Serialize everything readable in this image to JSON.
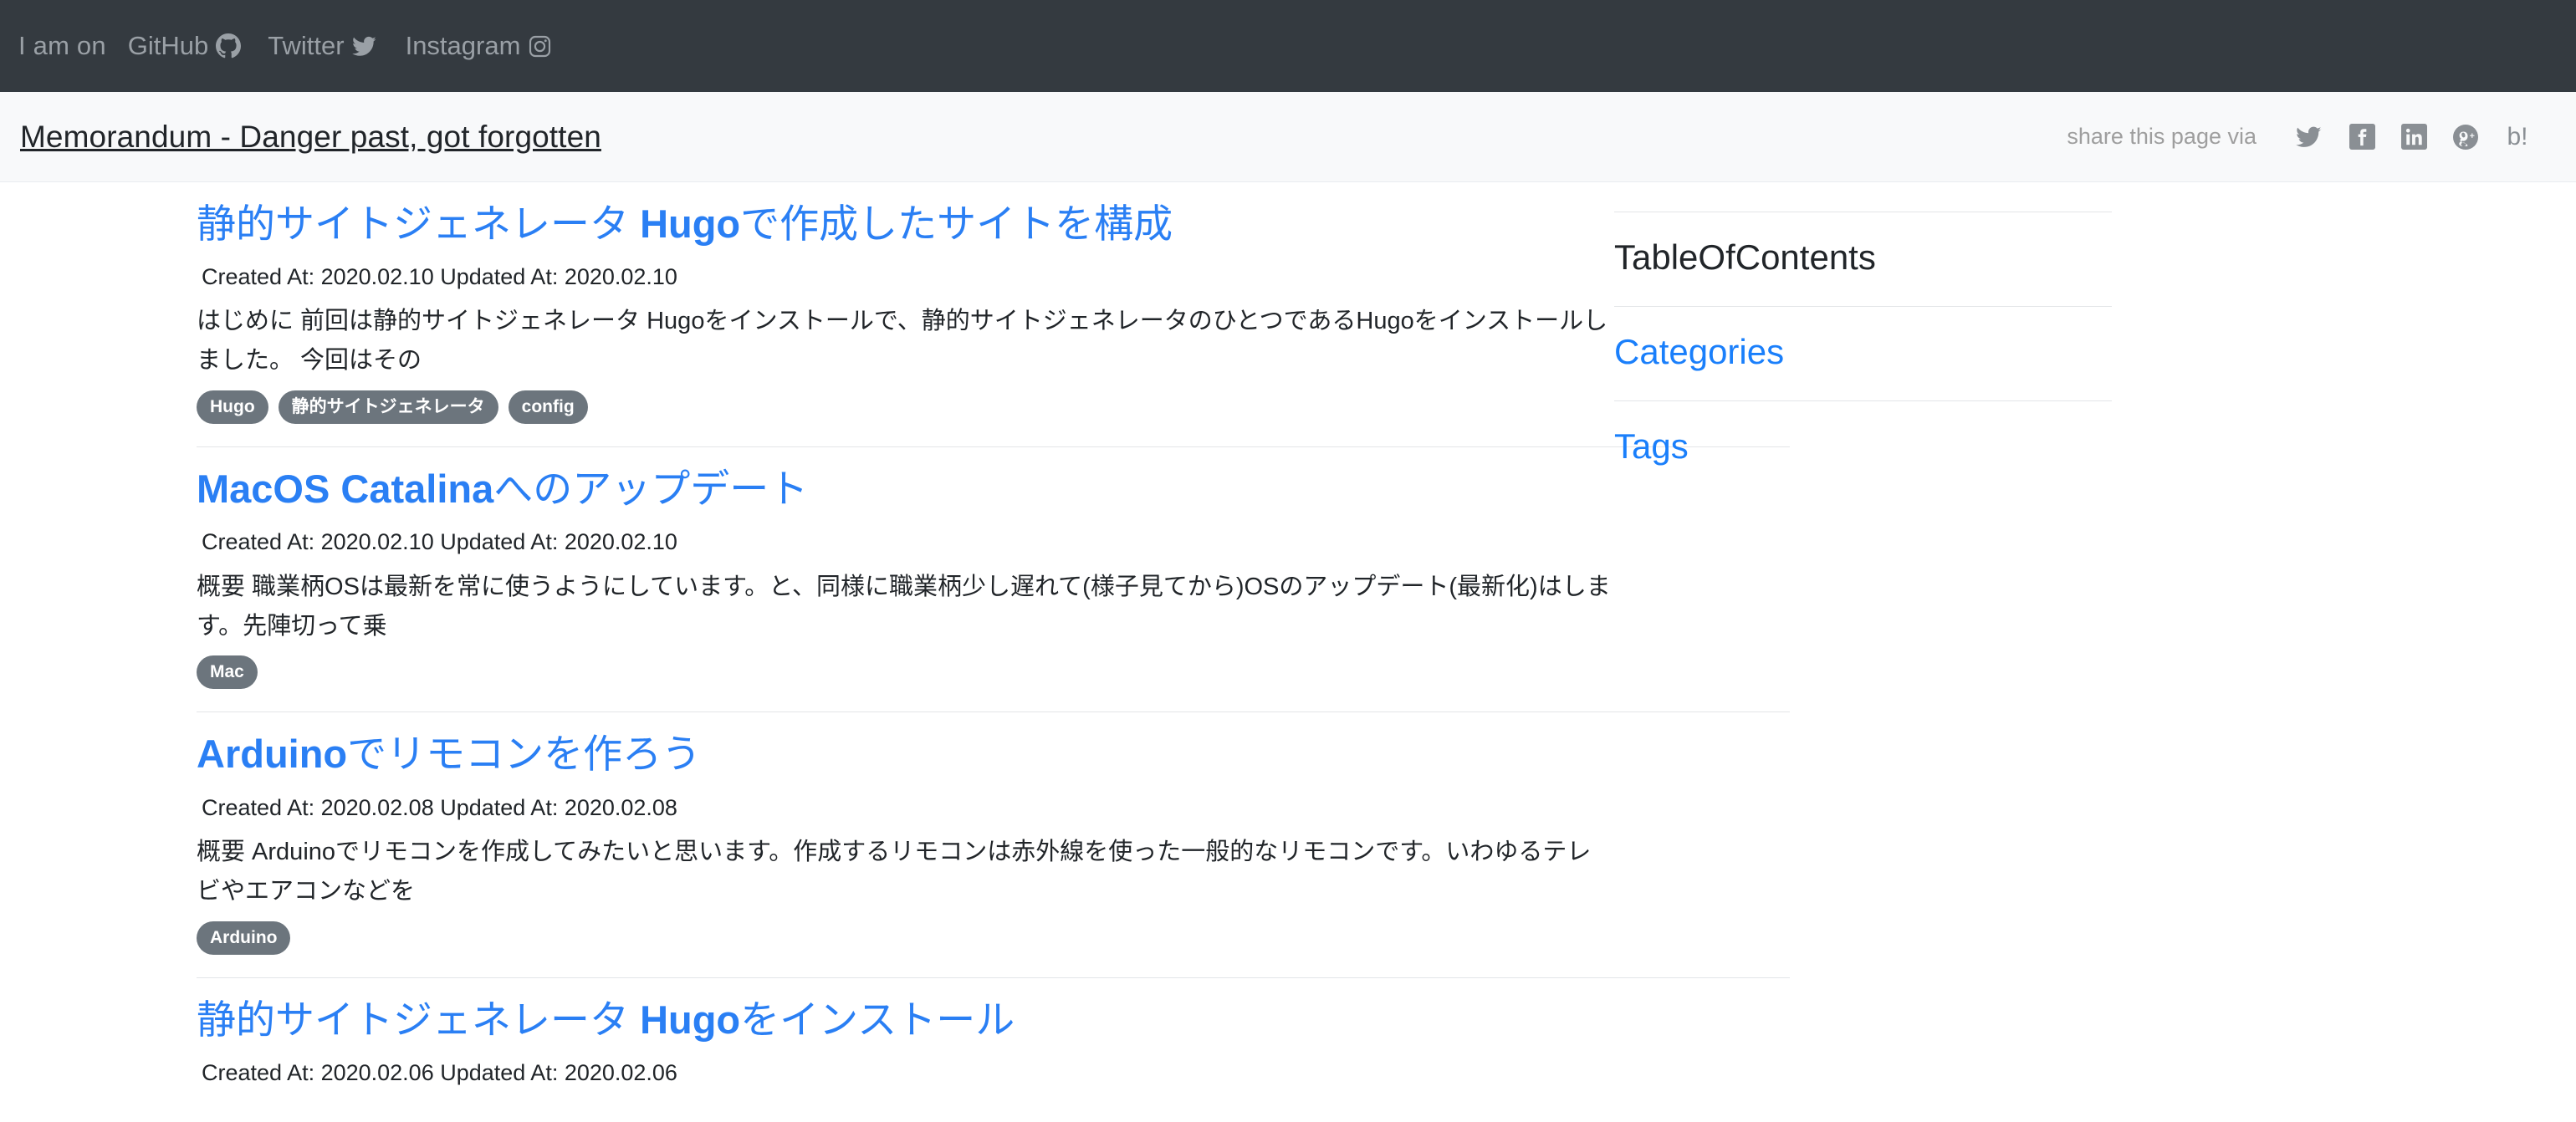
{
  "topnav": {
    "label": "I am on",
    "links": [
      {
        "text": "GitHub",
        "icon": "github-icon"
      },
      {
        "text": "Twitter",
        "icon": "twitter-icon"
      },
      {
        "text": "Instagram",
        "icon": "instagram-icon"
      }
    ],
    "background_color": "#343a40",
    "text_color": "#9aa0a6"
  },
  "header": {
    "site_title": "Memorandum - Danger past, got forgotten",
    "share_label": "share this page via",
    "share_icons": [
      {
        "name": "twitter-share-icon",
        "glyph": "twitter"
      },
      {
        "name": "facebook-share-icon",
        "glyph": "facebook"
      },
      {
        "name": "linkedin-share-icon",
        "glyph": "linkedin"
      },
      {
        "name": "googleplus-share-icon",
        "glyph": "google-plus"
      },
      {
        "name": "hatena-bookmark-share-icon",
        "glyph": "b!"
      }
    ],
    "background_color": "#f8f9fa"
  },
  "posts": [
    {
      "title_pre": "静的サイトジェネレータ ",
      "title_latin": "Hugo",
      "title_post": "で作成したサイトを構成",
      "created_label": "Created At:",
      "created": "2020.02.10",
      "updated_label": "Updated At:",
      "updated": "2020.02.10",
      "meta": "Created At: 2020.02.10 Updated At: 2020.02.10",
      "summary": "はじめに 前回は静的サイトジェネレータ Hugoをインストールで、静的サイトジェネレータのひとつであるHugoをインストールしました。 今回はその",
      "tags": [
        "Hugo",
        "静的サイトジェネレータ",
        "config"
      ]
    },
    {
      "title_pre": "",
      "title_latin": "MacOS Catalina",
      "title_post": "へのアップデート",
      "created_label": "Created At:",
      "created": "2020.02.10",
      "updated_label": "Updated At:",
      "updated": "2020.02.10",
      "meta": "Created At: 2020.02.10 Updated At: 2020.02.10",
      "summary": "概要 職業柄OSは最新を常に使うようにしています。と、同様に職業柄少し遅れて(様子見てから)OSのアップデート(最新化)はします。先陣切って乗",
      "tags": [
        "Mac"
      ]
    },
    {
      "title_pre": "",
      "title_latin": "Arduino",
      "title_post": "でリモコンを作ろう",
      "created_label": "Created At:",
      "created": "2020.02.08",
      "updated_label": "Updated At:",
      "updated": "2020.02.08",
      "meta": "Created At: 2020.02.08 Updated At: 2020.02.08",
      "summary": "概要 Arduinoでリモコンを作成してみたいと思います。作成するリモコンは赤外線を使った一般的なリモコンです。いわゆるテレビやエアコンなどを",
      "tags": [
        "Arduino"
      ]
    },
    {
      "title_pre": "静的サイトジェネレータ ",
      "title_latin": "Hugo",
      "title_post": "をインストール",
      "created_label": "Created At:",
      "created": "2020.02.06",
      "updated_label": "Updated At:",
      "updated": "2020.02.06",
      "meta": "Created At: 2020.02.06 Updated At: 2020.02.06",
      "summary": "",
      "tags": []
    }
  ],
  "sidebar": {
    "toc_heading": "TableOfContents",
    "categories_heading": "Categories",
    "tags_heading": "Tags",
    "link_color": "#1a7ffb"
  }
}
